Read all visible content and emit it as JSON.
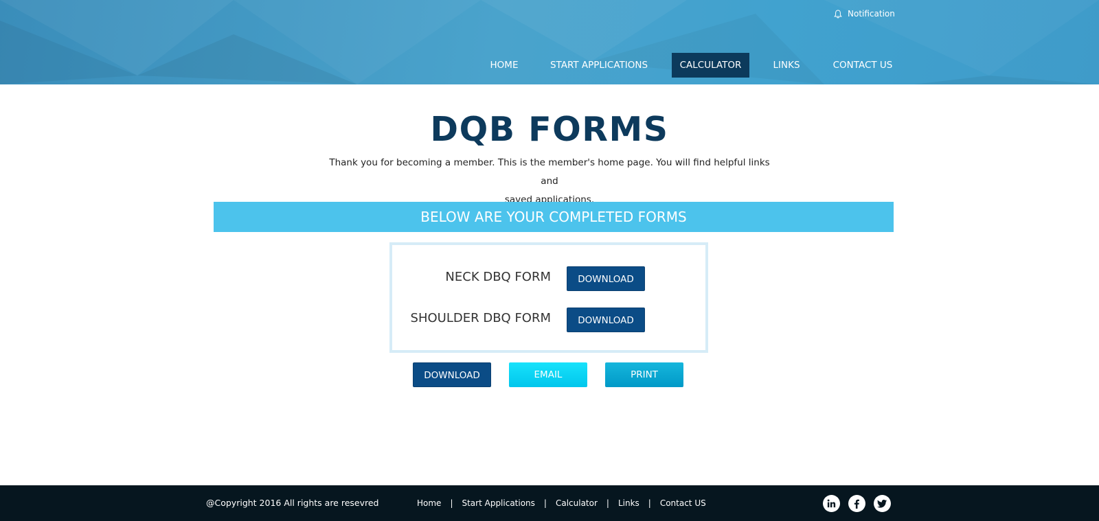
{
  "header": {
    "notification_label": "Notification",
    "nav": [
      {
        "label": "HOME",
        "active": false
      },
      {
        "label": "START APPLICATIONS",
        "active": false
      },
      {
        "label": "CALCULATOR",
        "active": true
      },
      {
        "label": "LINKS",
        "active": false
      },
      {
        "label": "CONTACT US",
        "active": false
      }
    ]
  },
  "main": {
    "title": "DQB FORMS",
    "intro_line1": "Thank you for becoming a member. This is the member's home page. You will find helpful links and",
    "intro_line2": "saved applications.",
    "banner": "BELOW ARE YOUR COMPLETED FORMS",
    "forms": [
      {
        "name": "NECK DBQ FORM",
        "button": "DOWNLOAD"
      },
      {
        "name": "SHOULDER DBQ FORM",
        "button": "DOWNLOAD"
      }
    ],
    "actions": {
      "download": "DOWNLOAD",
      "email": "EMAIL",
      "print": "PRINT"
    }
  },
  "footer": {
    "copyright": "@Copyright 2016 All rights are resevred",
    "links": [
      "Home",
      "Start Applications",
      "Calculator",
      "Links",
      "Contact US"
    ],
    "separator": "|",
    "social": [
      "linkedin-icon",
      "facebook-icon",
      "twitter-icon"
    ]
  },
  "colors": {
    "header": "#41a2cf",
    "nav_active": "#0c3a5c",
    "title": "#0d3a5c",
    "banner": "#4cc3ec",
    "btn_dark": "#0b4c86",
    "btn_cyan": "#00c6ec",
    "btn_teal": "#0099c7",
    "footer": "#06161f"
  }
}
